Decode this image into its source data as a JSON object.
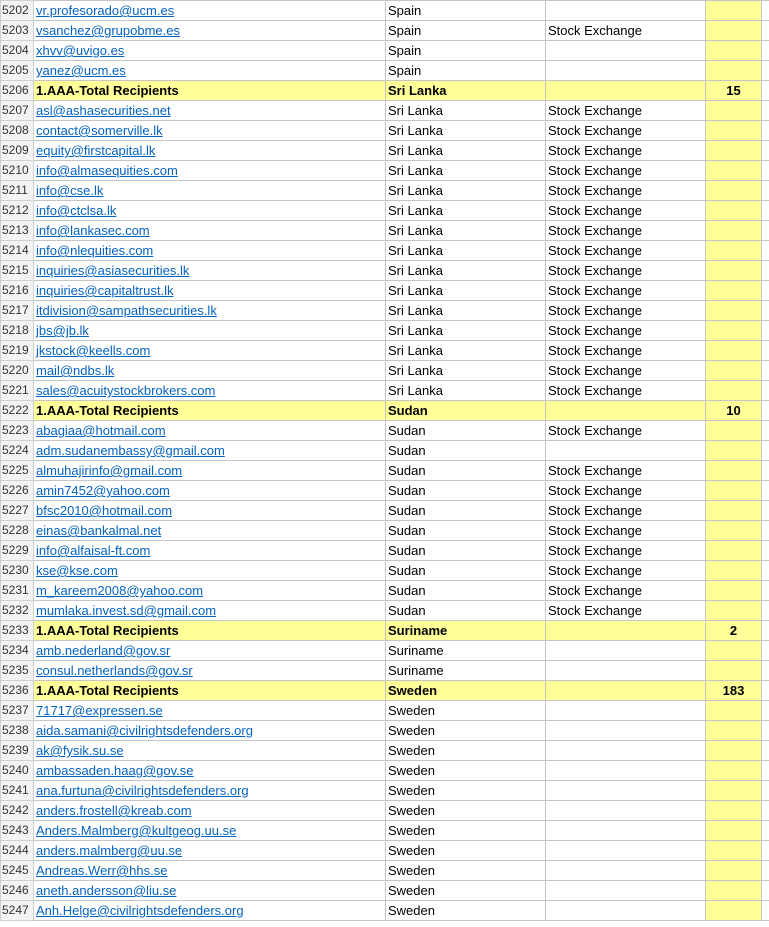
{
  "rows": [
    {
      "n": "5202",
      "email": "vr.profesorado@ucm.es",
      "country": "Spain",
      "type": ""
    },
    {
      "n": "5203",
      "email": "vsanchez@grupobme.es",
      "country": "Spain",
      "type": "Stock Exchange"
    },
    {
      "n": "5204",
      "email": "xhvv@uvigo.es",
      "country": "Spain",
      "type": ""
    },
    {
      "n": "5205",
      "email": "yanez@ucm.es",
      "country": "Spain",
      "type": ""
    },
    {
      "n": "5206",
      "total": true,
      "label": "1.AAA-Total Recipients",
      "country": "Sri Lanka",
      "count": "15"
    },
    {
      "n": "5207",
      "email": "asl@ashasecurities.net",
      "country": "Sri Lanka",
      "type": "Stock Exchange"
    },
    {
      "n": "5208",
      "email": "contact@somerville.lk",
      "country": "Sri Lanka",
      "type": "Stock Exchange"
    },
    {
      "n": "5209",
      "email": "equity@firstcapital.lk",
      "country": "Sri Lanka",
      "type": "Stock Exchange"
    },
    {
      "n": "5210",
      "email": "info@almasequities.com",
      "country": "Sri Lanka",
      "type": "Stock Exchange"
    },
    {
      "n": "5211",
      "email": "info@cse.lk",
      "country": "Sri Lanka",
      "type": "Stock Exchange"
    },
    {
      "n": "5212",
      "email": "info@ctclsa.lk",
      "country": "Sri Lanka",
      "type": "Stock Exchange"
    },
    {
      "n": "5213",
      "email": "info@lankasec.com",
      "country": "Sri Lanka",
      "type": "Stock Exchange"
    },
    {
      "n": "5214",
      "email": "info@nlequities.com",
      "country": "Sri Lanka",
      "type": "Stock Exchange"
    },
    {
      "n": "5215",
      "email": "inquiries@asiasecurities.lk",
      "country": "Sri Lanka",
      "type": "Stock Exchange"
    },
    {
      "n": "5216",
      "email": "inquiries@capitaltrust.lk",
      "country": "Sri Lanka",
      "type": "Stock Exchange"
    },
    {
      "n": "5217",
      "email": "itdivision@sampathsecurities.lk",
      "country": "Sri Lanka",
      "type": "Stock Exchange"
    },
    {
      "n": "5218",
      "email": "jbs@jb.lk",
      "country": "Sri Lanka",
      "type": "Stock Exchange"
    },
    {
      "n": "5219",
      "email": "jkstock@keells.com",
      "country": "Sri Lanka",
      "type": "Stock Exchange"
    },
    {
      "n": "5220",
      "email": "mail@ndbs.lk",
      "country": "Sri Lanka",
      "type": "Stock Exchange"
    },
    {
      "n": "5221",
      "email": "sales@acuitystockbrokers.com",
      "country": "Sri Lanka",
      "type": "Stock Exchange"
    },
    {
      "n": "5222",
      "total": true,
      "label": "1.AAA-Total Recipients",
      "country": "Sudan",
      "count": "10"
    },
    {
      "n": "5223",
      "email": "abagiaa@hotmail.com",
      "country": "Sudan",
      "type": "Stock Exchange"
    },
    {
      "n": "5224",
      "email": "adm.sudanembassy@gmail.com",
      "country": "Sudan",
      "type": ""
    },
    {
      "n": "5225",
      "email": "almuhajirinfo@gmail.com",
      "country": "Sudan",
      "type": "Stock Exchange"
    },
    {
      "n": "5226",
      "email": "amin7452@yahoo.com",
      "country": "Sudan",
      "type": "Stock Exchange"
    },
    {
      "n": "5227",
      "email": "bfsc2010@hotmail.com",
      "country": "Sudan",
      "type": "Stock Exchange"
    },
    {
      "n": "5228",
      "email": "einas@bankalmal.net",
      "country": "Sudan",
      "type": "Stock Exchange"
    },
    {
      "n": "5229",
      "email": "info@alfaisal-ft.com",
      "country": "Sudan",
      "type": "Stock Exchange"
    },
    {
      "n": "5230",
      "email": "kse@kse.com",
      "country": "Sudan",
      "type": "Stock Exchange"
    },
    {
      "n": "5231",
      "email": "m_kareem2008@yahoo.com",
      "country": "Sudan",
      "type": "Stock Exchange"
    },
    {
      "n": "5232",
      "email": "mumlaka.invest.sd@gmail.com",
      "country": "Sudan",
      "type": "Stock Exchange"
    },
    {
      "n": "5233",
      "total": true,
      "label": "1.AAA-Total Recipients",
      "country": "Suriname",
      "count": "2"
    },
    {
      "n": "5234",
      "email": "amb.nederland@gov.sr",
      "country": "Suriname",
      "type": ""
    },
    {
      "n": "5235",
      "email": "consul.netherlands@gov.sr",
      "country": "Suriname",
      "type": ""
    },
    {
      "n": "5236",
      "total": true,
      "label": "1.AAA-Total Recipients",
      "country": "Sweden",
      "count": "183"
    },
    {
      "n": "5237",
      "email": "71717@expressen.se",
      "country": "Sweden",
      "type": ""
    },
    {
      "n": "5238",
      "email": "aida.samani@civilrightsdefenders.org",
      "country": "Sweden",
      "type": ""
    },
    {
      "n": "5239",
      "email": "ak@fysik.su.se",
      "country": "Sweden",
      "type": ""
    },
    {
      "n": "5240",
      "email": "ambassaden.haag@gov.se",
      "country": "Sweden",
      "type": ""
    },
    {
      "n": "5241",
      "email": "ana.furtuna@civilrightsdefenders.org",
      "country": "Sweden",
      "type": ""
    },
    {
      "n": "5242",
      "email": "anders.frostell@kreab.com",
      "country": "Sweden",
      "type": ""
    },
    {
      "n": "5243",
      "email": "Anders.Malmberg@kultgeog.uu.se",
      "country": "Sweden",
      "type": ""
    },
    {
      "n": "5244",
      "email": "anders.malmberg@uu.se",
      "country": "Sweden",
      "type": ""
    },
    {
      "n": "5245",
      "email": "Andreas.Werr@hhs.se",
      "country": "Sweden",
      "type": ""
    },
    {
      "n": "5246",
      "email": "aneth.andersson@liu.se",
      "country": "Sweden",
      "type": ""
    },
    {
      "n": "5247",
      "email": "Anh.Helge@civilrightsdefenders.org",
      "country": "Sweden",
      "type": ""
    }
  ]
}
